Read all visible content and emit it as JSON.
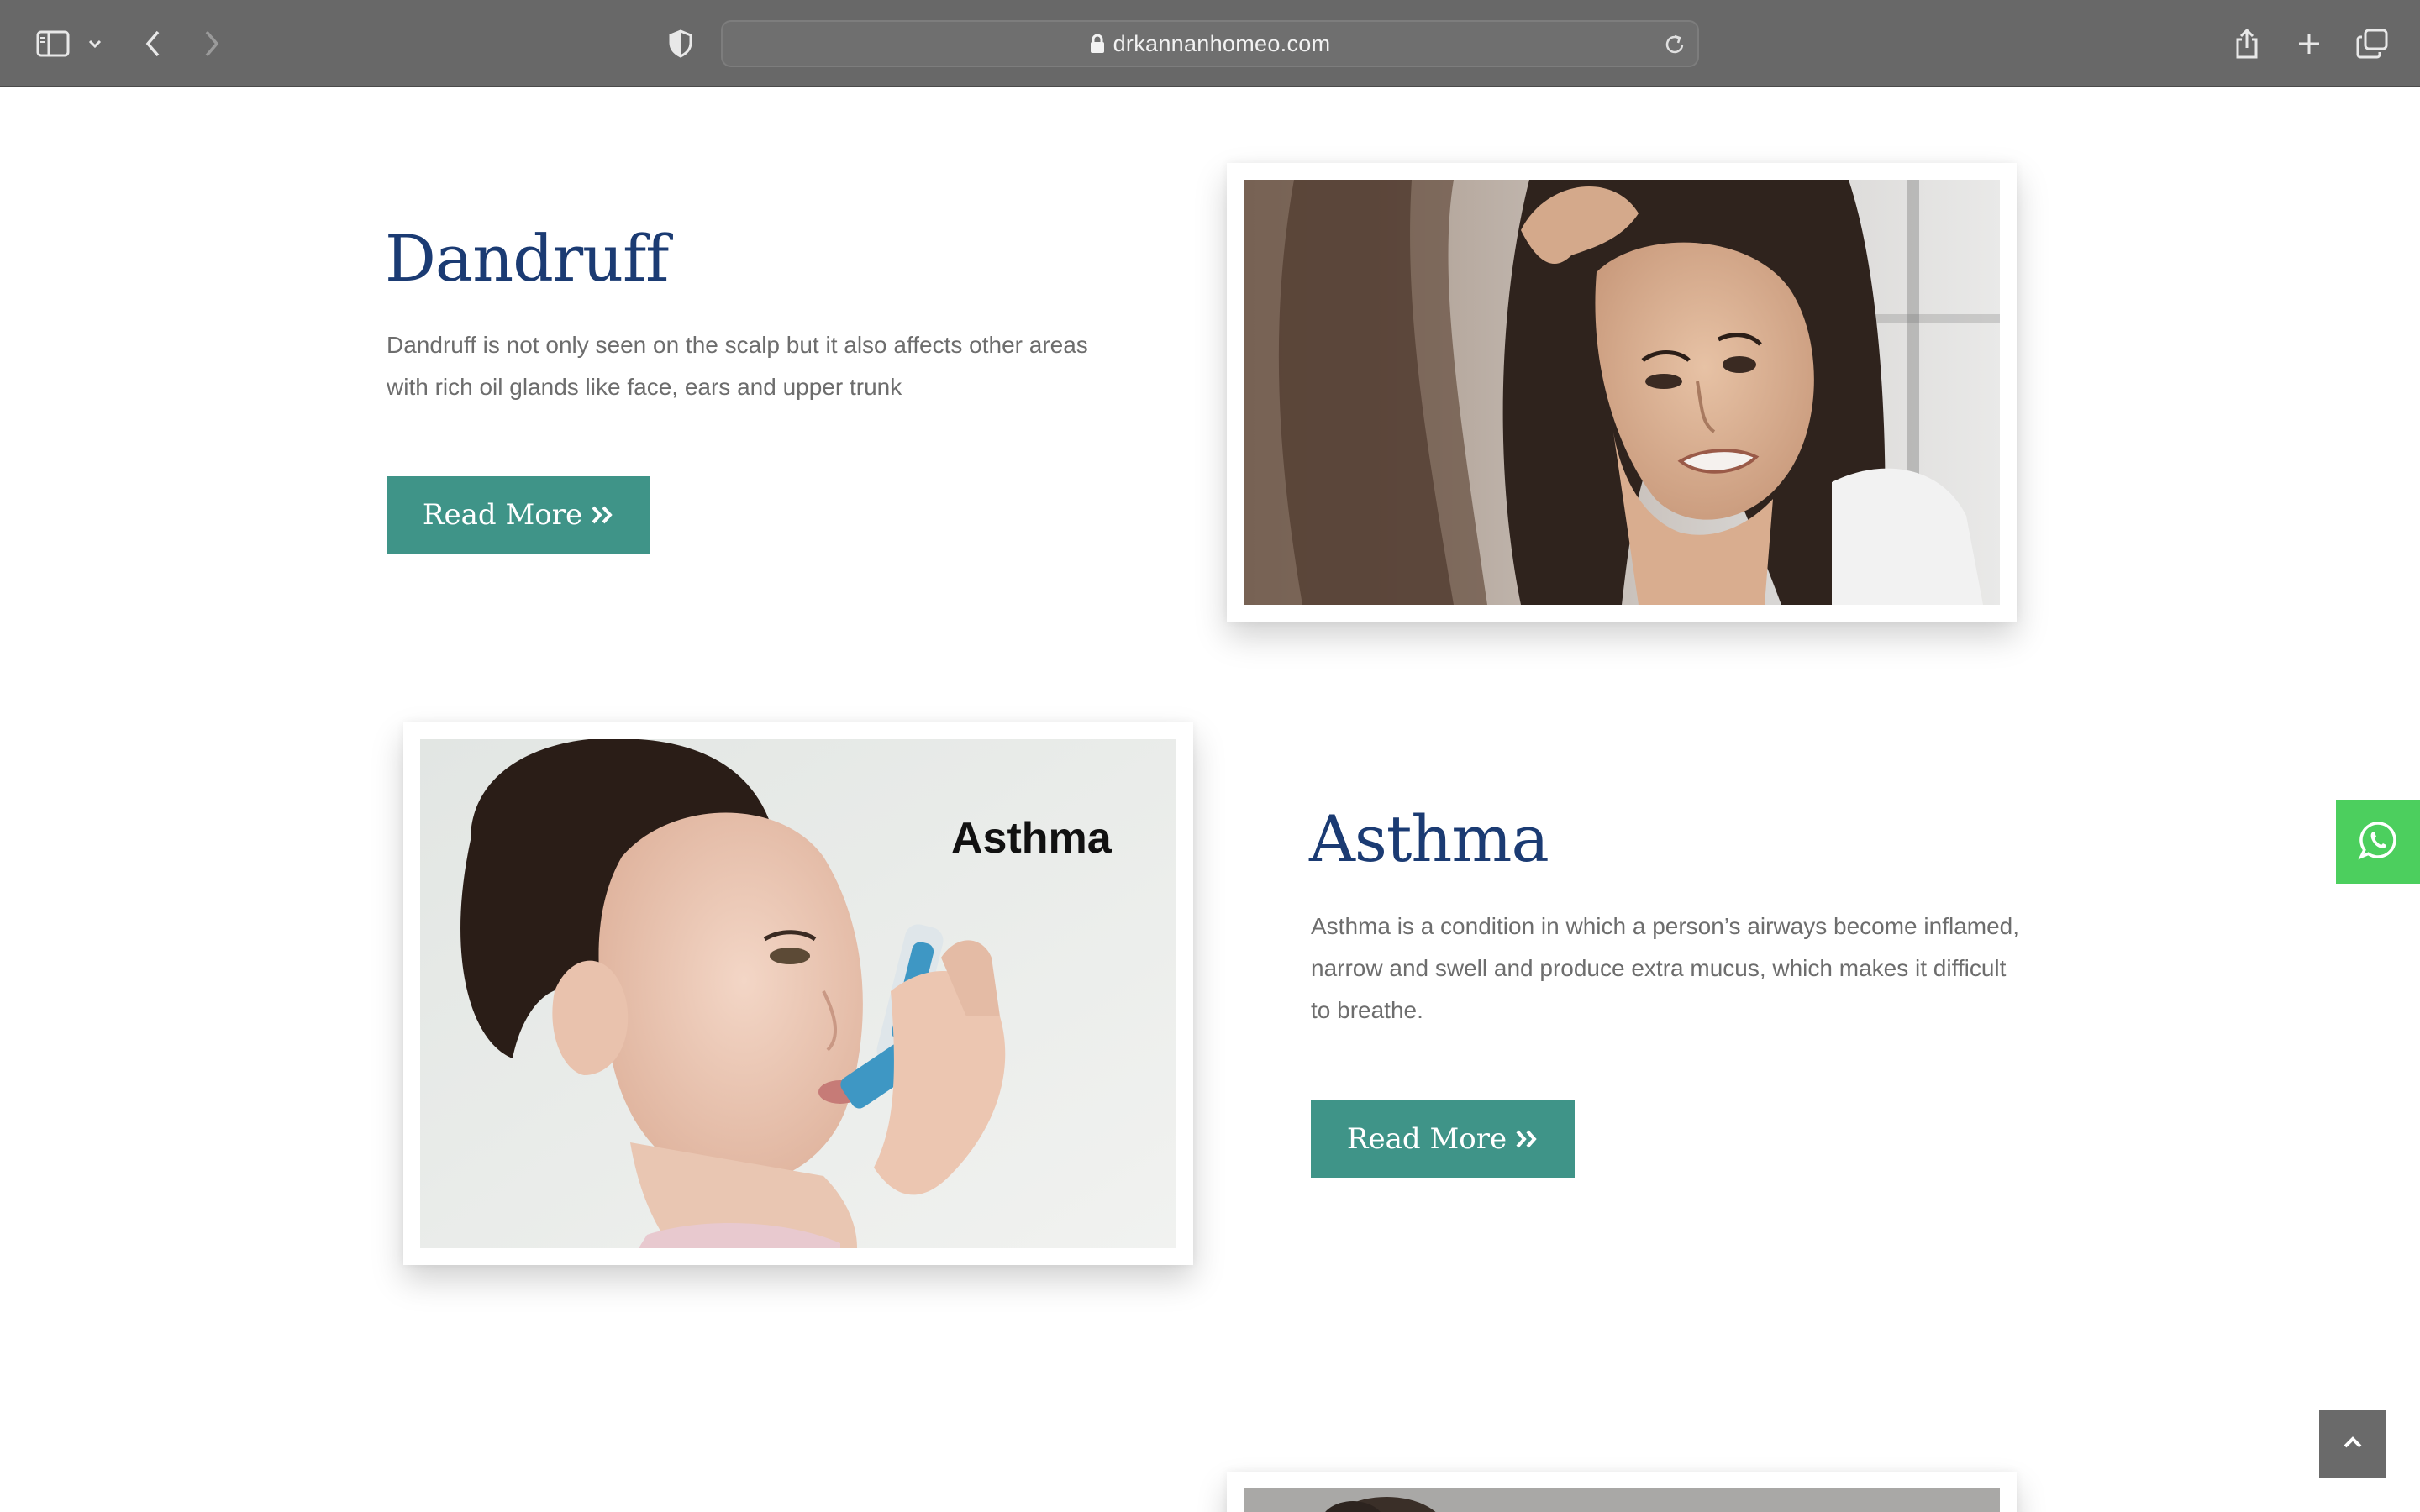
{
  "browser": {
    "url": "drkannanhomeo.com",
    "icons": [
      "sidebar-icon",
      "chevron-down-icon",
      "back-icon",
      "forward-icon",
      "shield-icon",
      "lock-icon",
      "reload-icon",
      "share-icon",
      "new-tab-icon",
      "tabs-overview-icon"
    ]
  },
  "sections": [
    {
      "title": "Dandruff",
      "description_lines": [
        "Dandruff is not only seen on the scalp but it also affects other areas",
        "with rich oil glands like face, ears and upper trunk"
      ],
      "button_label": "Read More"
    },
    {
      "title": "Asthma",
      "image_overlay_text": "Asthma",
      "description_lines": [
        "Asthma is a condition in which a person’s airways become inflamed,",
        "narrow and swell and produce extra mucus, which makes it difficult",
        "to breathe."
      ],
      "button_label": "Read More"
    }
  ],
  "floating": {
    "whatsapp_icon": "whatsapp-icon",
    "scroll_top_icon": "chevron-up-icon"
  },
  "colors": {
    "toolbar": "#686868",
    "heading": "#1b3b73",
    "button": "#3f9488",
    "whatsapp": "#4ccf5e",
    "scroll_top": "#6a6a6a"
  }
}
